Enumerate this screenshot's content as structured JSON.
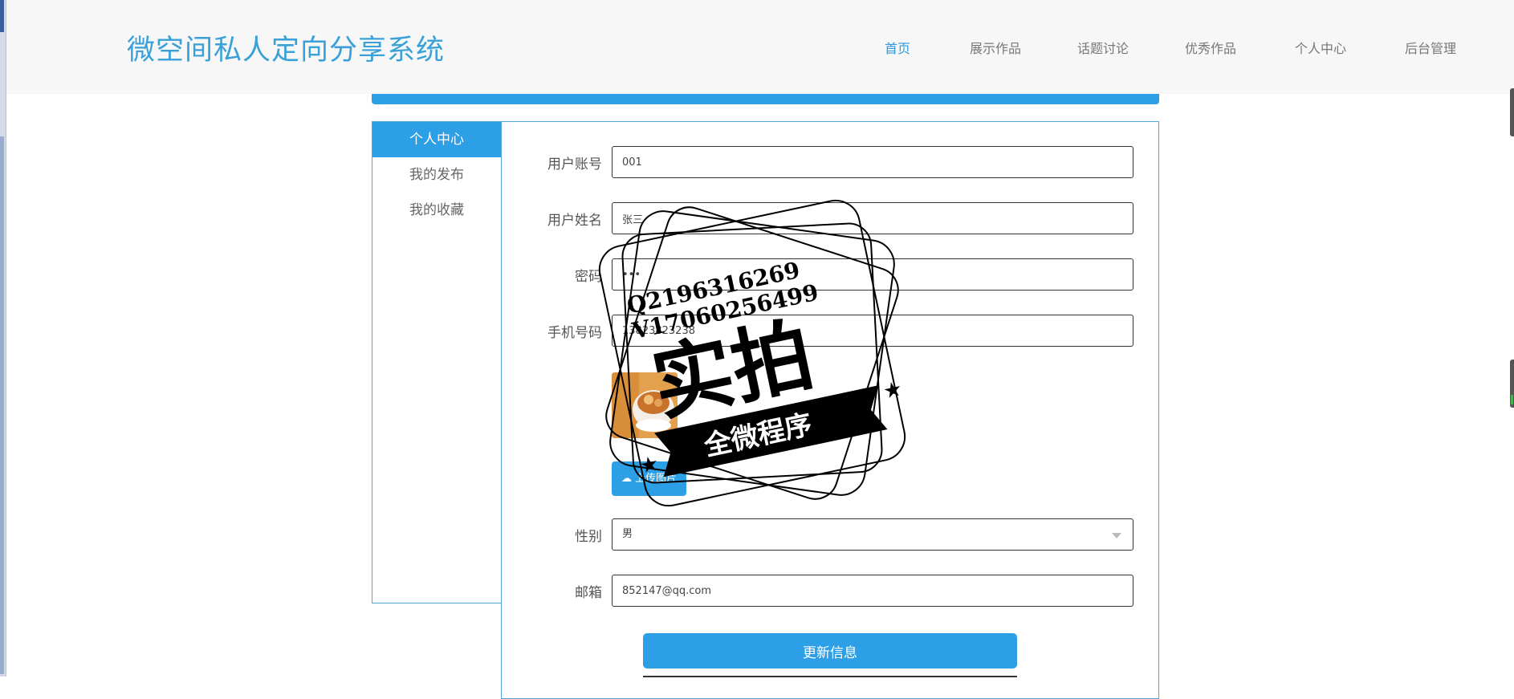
{
  "site": {
    "title": "微空间私人定向分享系统"
  },
  "nav": {
    "items": [
      {
        "label": "首页",
        "active": true
      },
      {
        "label": "展示作品",
        "active": false
      },
      {
        "label": "话题讨论",
        "active": false
      },
      {
        "label": "优秀作品",
        "active": false
      },
      {
        "label": "个人中心",
        "active": false
      },
      {
        "label": "后台管理",
        "active": false
      }
    ]
  },
  "sidebar": {
    "items": [
      {
        "label": "个人中心",
        "active": true
      },
      {
        "label": "我的发布",
        "active": false
      },
      {
        "label": "我的收藏",
        "active": false
      }
    ]
  },
  "form": {
    "account": {
      "label": "用户账号",
      "value": "001"
    },
    "name": {
      "label": "用户姓名",
      "value": "张三"
    },
    "password": {
      "label": "密码",
      "value": "•••"
    },
    "phone": {
      "label": "手机号码",
      "value": "13823823238"
    },
    "avatar": {
      "upload_label": "上传图片"
    },
    "gender": {
      "label": "性别",
      "value": "男"
    },
    "email": {
      "label": "邮箱",
      "value": "852147@qq.com"
    },
    "submit_label": "更新信息"
  },
  "watermark": {
    "line1": "Q2196316269",
    "line2": "V17060256499",
    "main": "实拍",
    "banner": "全微程序"
  },
  "colors": {
    "accent": "#2d9fe6",
    "title": "#3aa0d8",
    "header_bg": "#f7f7f7"
  }
}
